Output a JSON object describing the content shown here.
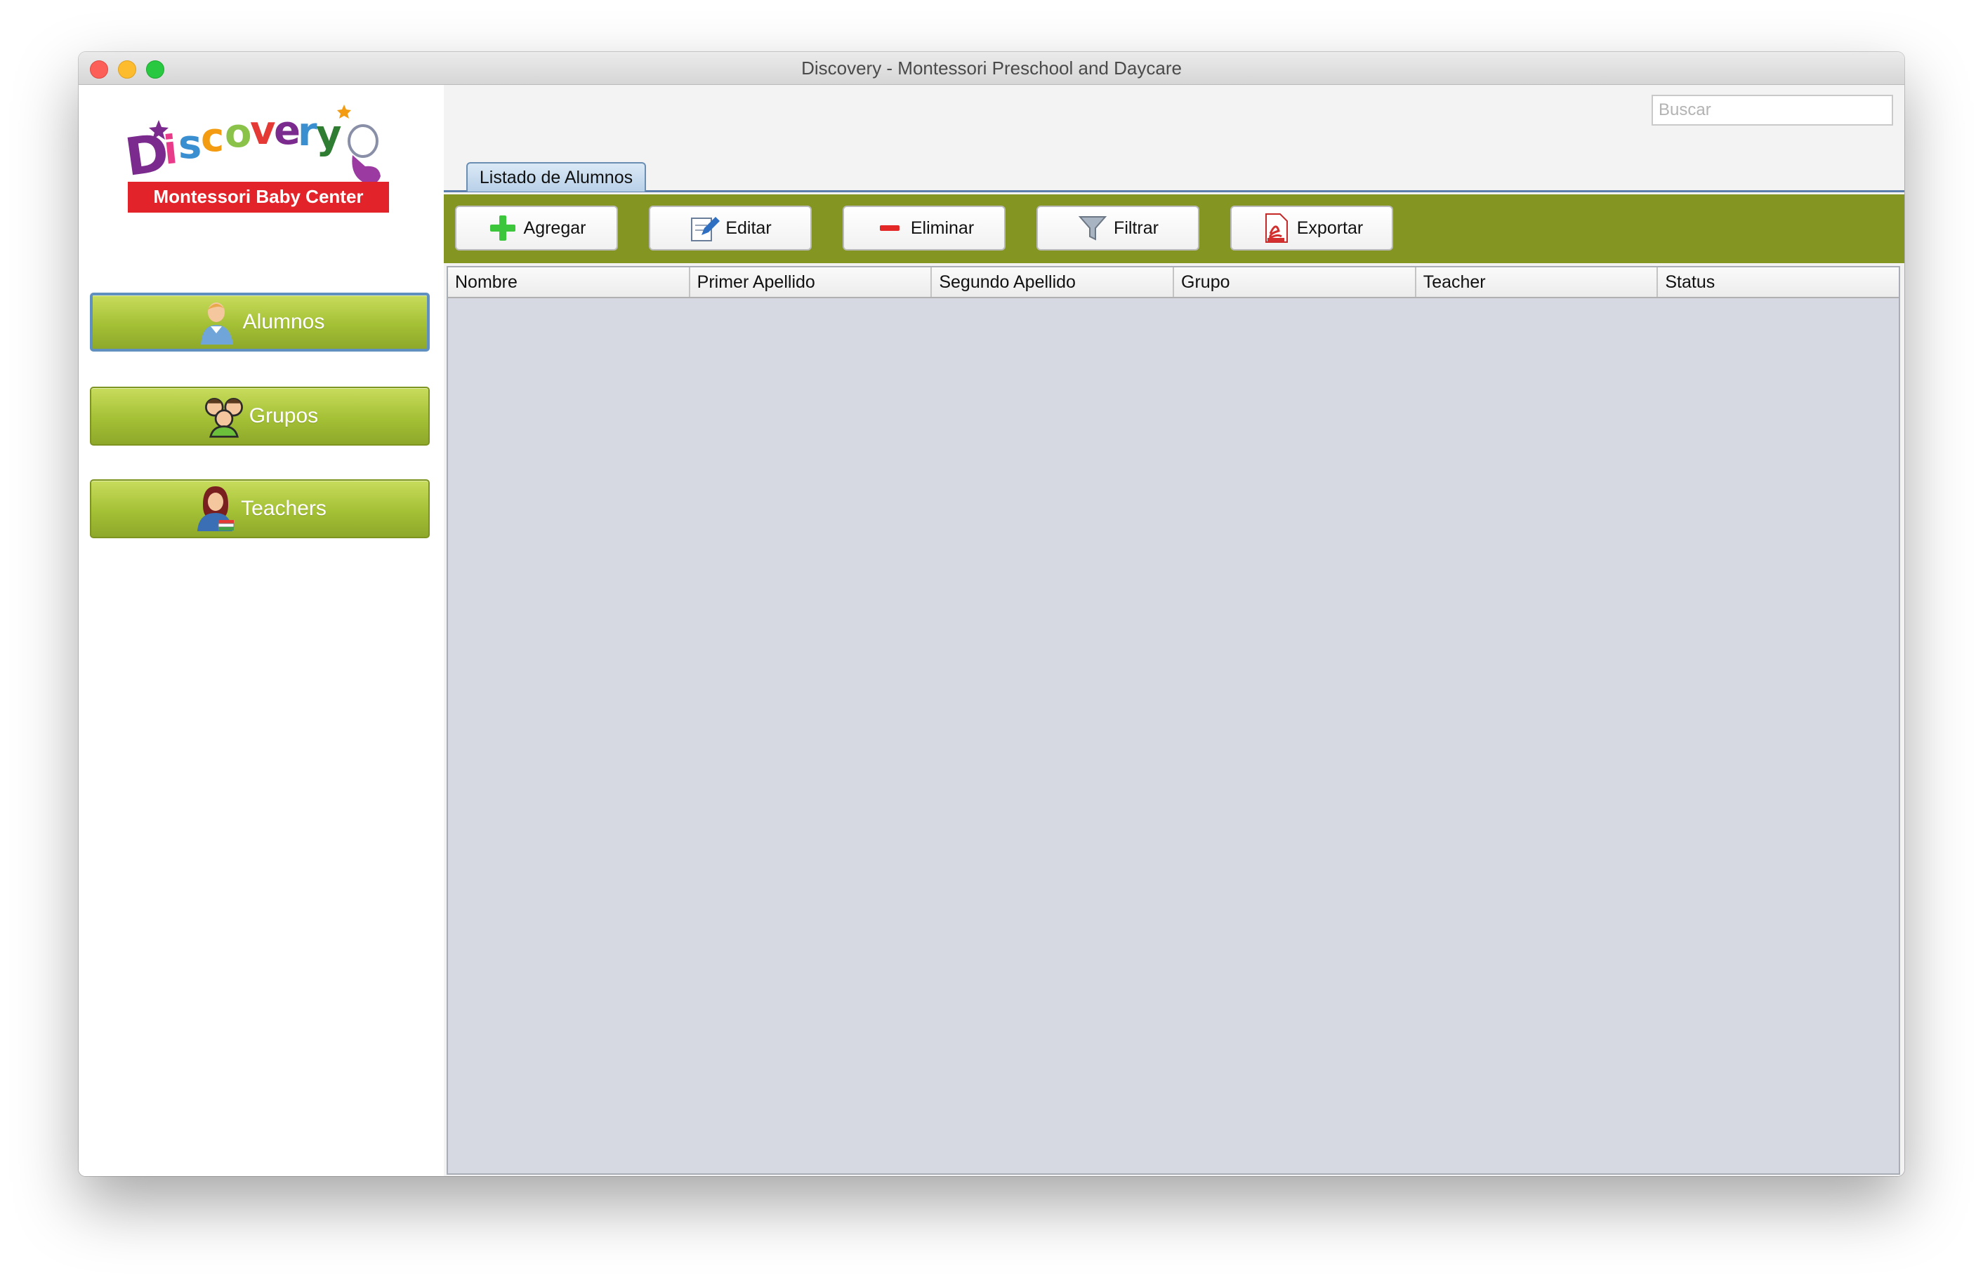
{
  "window": {
    "title": "Discovery - Montessori Preschool and Daycare"
  },
  "logo": {
    "brand": "Discovery",
    "tagline": "Montessori Baby Center"
  },
  "sidebar": {
    "items": [
      {
        "label": "Alumnos",
        "icon": "student-icon",
        "active": true
      },
      {
        "label": "Grupos",
        "icon": "group-icon",
        "active": false
      },
      {
        "label": "Teachers",
        "icon": "teacher-icon",
        "active": false
      }
    ]
  },
  "search": {
    "placeholder": "Buscar",
    "value": ""
  },
  "tabs": [
    {
      "label": "Listado de Alumnos",
      "active": true
    }
  ],
  "toolbar": {
    "buttons": [
      {
        "label": "Agregar",
        "icon": "plus-icon"
      },
      {
        "label": "Editar",
        "icon": "edit-icon"
      },
      {
        "label": "Eliminar",
        "icon": "minus-icon"
      },
      {
        "label": "Filtrar",
        "icon": "funnel-icon"
      },
      {
        "label": "Exportar",
        "icon": "pdf-icon"
      }
    ]
  },
  "table": {
    "columns": [
      "Nombre",
      "Primer Apellido",
      "Segundo Apellido",
      "Grupo",
      "Teacher",
      "Status"
    ],
    "rows": []
  },
  "colors": {
    "toolbar": "#849522",
    "nav_button": "#a4c035",
    "table_body": "#d6d9e1",
    "tab_accent": "#5b7faa",
    "logo_banner": "#e3232a"
  }
}
